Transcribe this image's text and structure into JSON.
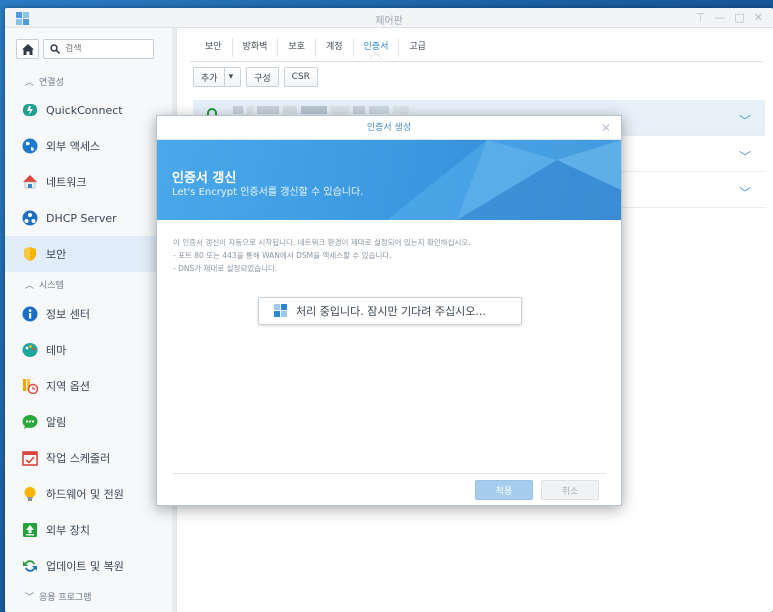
{
  "window": {
    "title": "제어판"
  },
  "sidebar": {
    "search_placeholder": "검색",
    "sections": {
      "connectivity": "연결성",
      "system": "시스템",
      "apps": "응용 프로그램"
    },
    "items": [
      {
        "label": "QuickConnect",
        "icon": "quickconnect-icon"
      },
      {
        "label": "외부 액세스",
        "icon": "globe-icon"
      },
      {
        "label": "네트워크",
        "icon": "network-house-icon"
      },
      {
        "label": "DHCP Server",
        "icon": "dhcp-icon"
      },
      {
        "label": "보안",
        "icon": "shield-icon",
        "active": true
      },
      {
        "label": "정보 센터",
        "icon": "info-icon"
      },
      {
        "label": "테마",
        "icon": "palette-icon"
      },
      {
        "label": "지역 옵션",
        "icon": "regional-clock-icon"
      },
      {
        "label": "알림",
        "icon": "chat-bubble-icon"
      },
      {
        "label": "작업 스케줄러",
        "icon": "calendar-icon"
      },
      {
        "label": "하드웨어 및 전원",
        "icon": "lightbulb-icon"
      },
      {
        "label": "외부 장치",
        "icon": "external-device-icon"
      },
      {
        "label": "업데이트 및 복원",
        "icon": "update-arrows-icon"
      }
    ]
  },
  "tabs": [
    {
      "label": "보안"
    },
    {
      "label": "방화벽"
    },
    {
      "label": "보호"
    },
    {
      "label": "계정"
    },
    {
      "label": "인증서",
      "active": true
    },
    {
      "label": "고급"
    }
  ],
  "toolbar": {
    "add_label": "추가",
    "configure_label": "구성",
    "csr_label": "CSR"
  },
  "dialog": {
    "title": "인증서 생성",
    "banner_title": "인증서 갱신",
    "banner_subtitle": "Let's Encrypt 인증서를 갱신할 수 있습니다.",
    "info_lines": [
      "이 인증서 갱신이 자동으로 시작됩니다. 네트워크 환경이 제대로 설정되어 있는지 확인하십시오.",
      "- 포트 80 또는 443을 통해 WAN에서 DSM을 액세스할 수 있습니다.",
      "- DNS가 제대로 설정되었습니다."
    ],
    "progress_text": "처리 중입니다. 잠시만 기다려 주십시오...",
    "apply_label": "적용",
    "cancel_label": "취소"
  },
  "colors": {
    "accent": "#2b86d6",
    "banner": "#3b98e0",
    "active_nav": "#e1edf8"
  }
}
